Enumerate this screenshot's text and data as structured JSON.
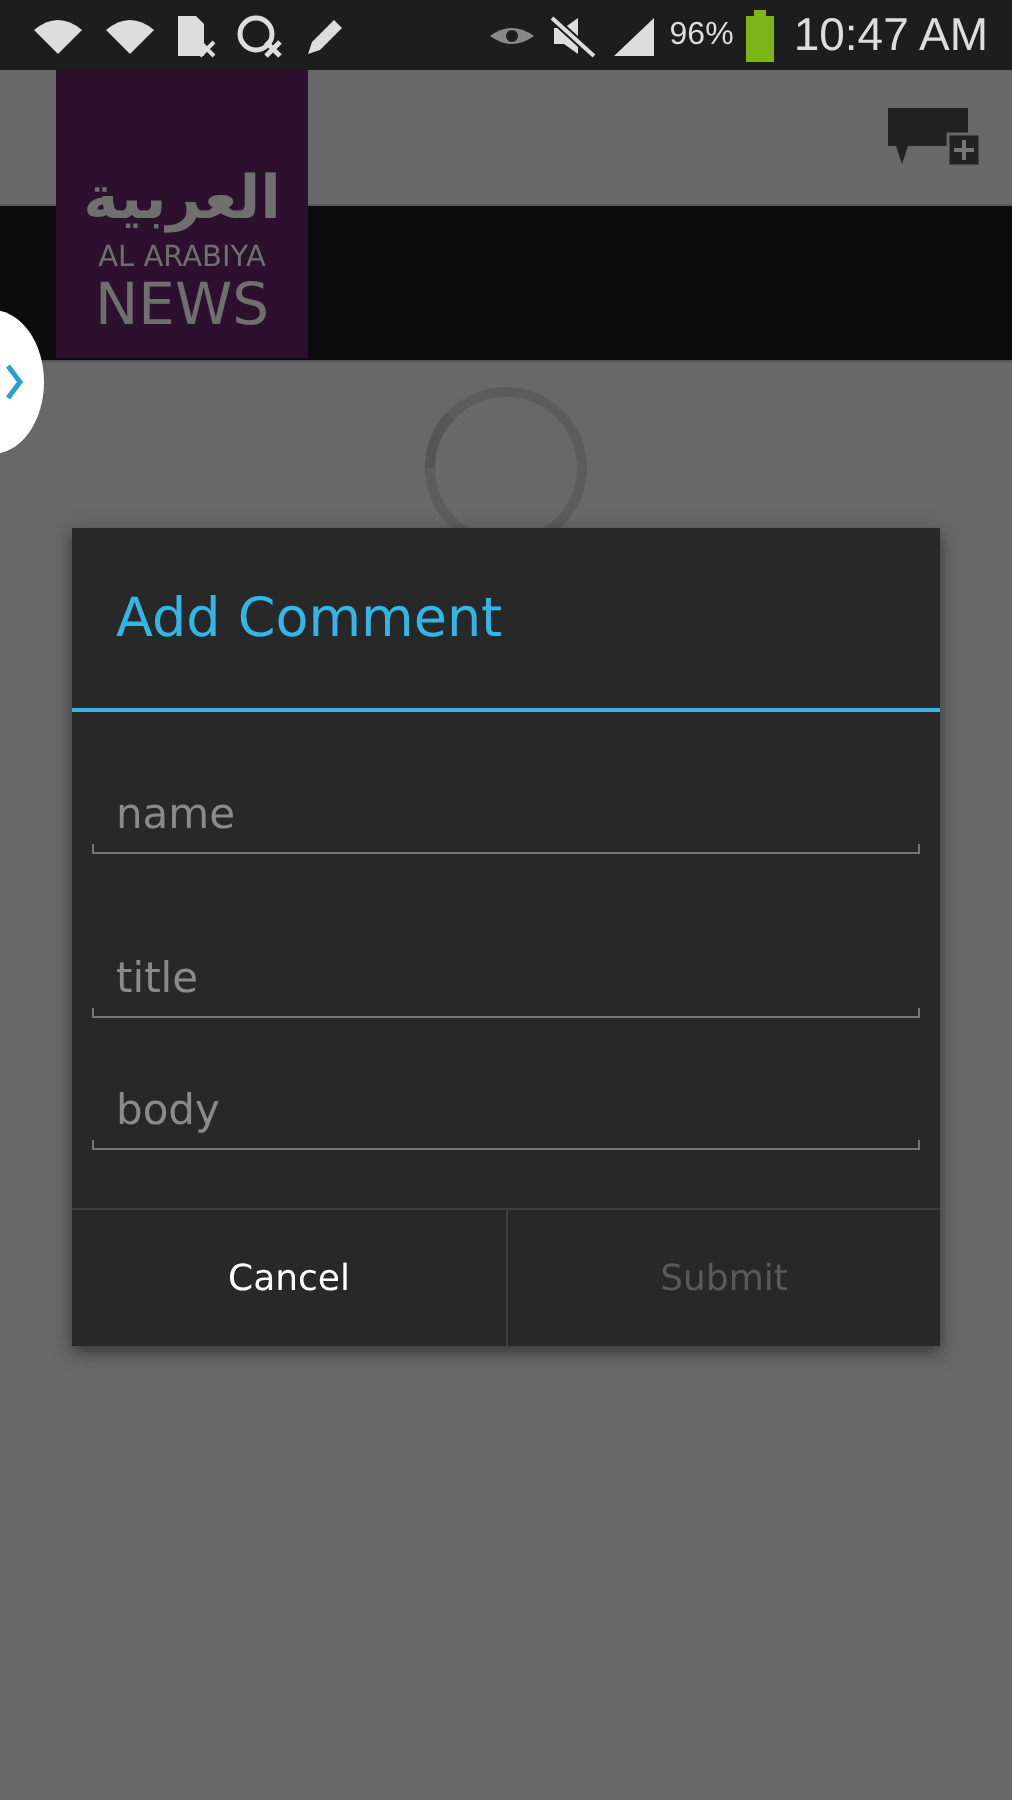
{
  "status_bar": {
    "battery": "96%",
    "time": "10:47 AM"
  },
  "header": {
    "logo": {
      "arabic": "العربية",
      "line1": "AL ARABIYA",
      "line2": "NEWS"
    }
  },
  "dialog": {
    "title": "Add Comment",
    "fields": [
      {
        "placeholder": "name"
      },
      {
        "placeholder": "title"
      },
      {
        "placeholder": "body"
      }
    ],
    "buttons": [
      {
        "label": "Cancel",
        "disabled": false
      },
      {
        "label": "Submit",
        "disabled": true
      }
    ]
  }
}
